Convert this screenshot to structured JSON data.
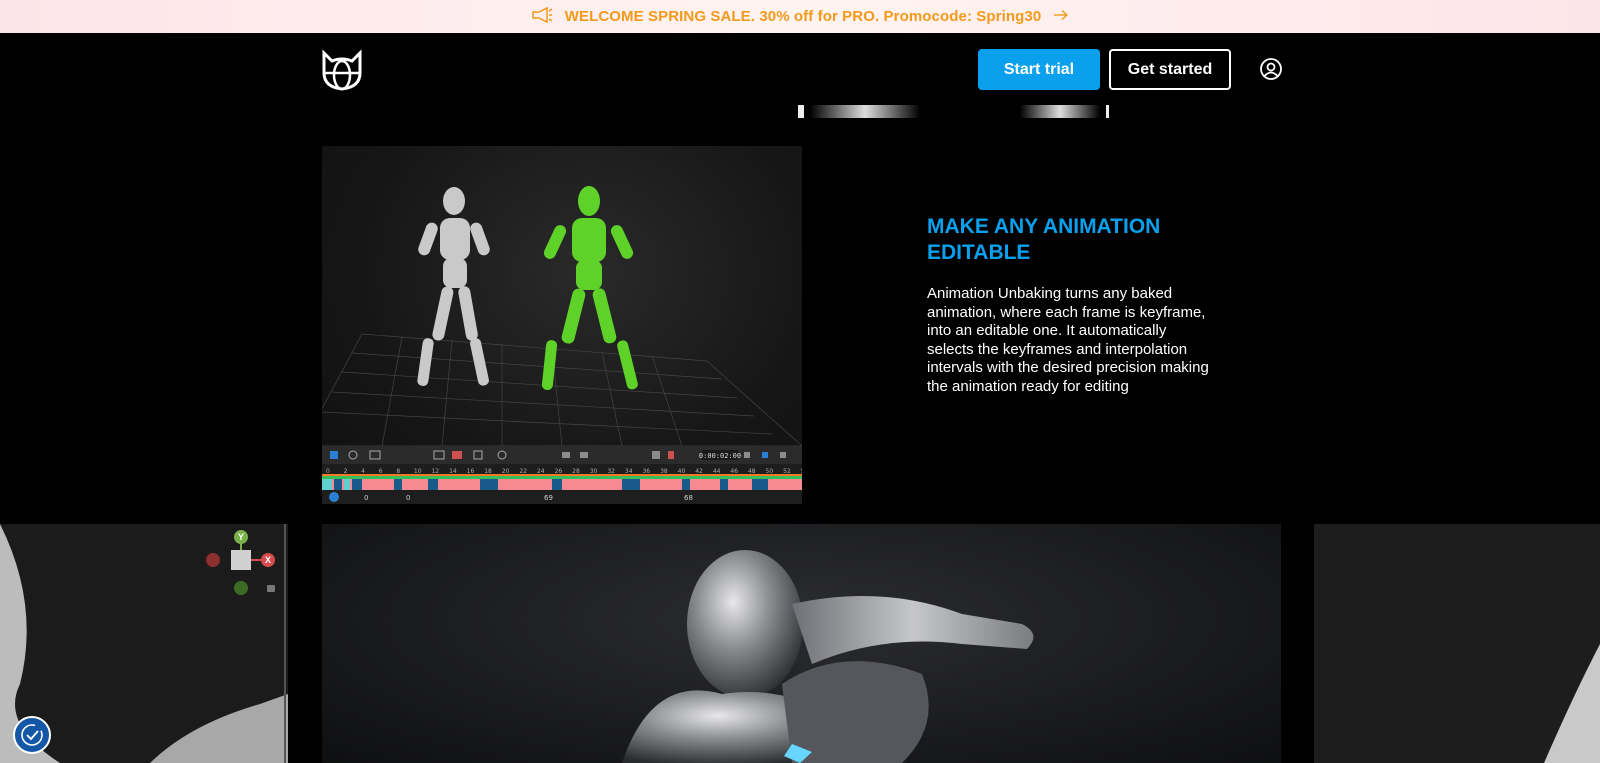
{
  "promo": {
    "text": "WELCOME SPRING SALE. 30% off for PRO. Promocode: Spring30",
    "icon": "megaphone-icon",
    "arrow_icon": "arrow-right-icon",
    "text_color": "#f39a1b"
  },
  "header": {
    "logo": "cat-globe-logo",
    "start_trial_label": "Start trial",
    "get_started_label": "Get started",
    "user_icon": "user-icon",
    "accent_color": "#0aa0ee"
  },
  "feature": {
    "title": "MAKE ANY ANIMATION EDITABLE",
    "description": "Animation Unbaking turns any baked animation, where each frame is keyframe, into an editable one. It automatically selects the keyframes and interpolation intervals with the desired precision making the animation ready for editing",
    "timeline": {
      "time": "0:00:02:00",
      "ruler_ticks": [
        "0",
        "2",
        "4",
        "6",
        "8",
        "10",
        "12",
        "14",
        "16",
        "18",
        "20",
        "22",
        "24",
        "26",
        "28",
        "30",
        "32",
        "34",
        "36",
        "38",
        "40",
        "42",
        "44",
        "46",
        "48",
        "50",
        "52",
        "5"
      ],
      "footer_values": [
        "0",
        "0",
        "69",
        "68"
      ],
      "key_color": "#f58a93",
      "marker_color": "#1a5a8a"
    }
  },
  "gizmo": {
    "y_label": "Y",
    "x_label": "X",
    "lock_icon": "lock-icon"
  },
  "cookie": {
    "icon": "cookie-settings-icon",
    "color": "#1457a6"
  }
}
